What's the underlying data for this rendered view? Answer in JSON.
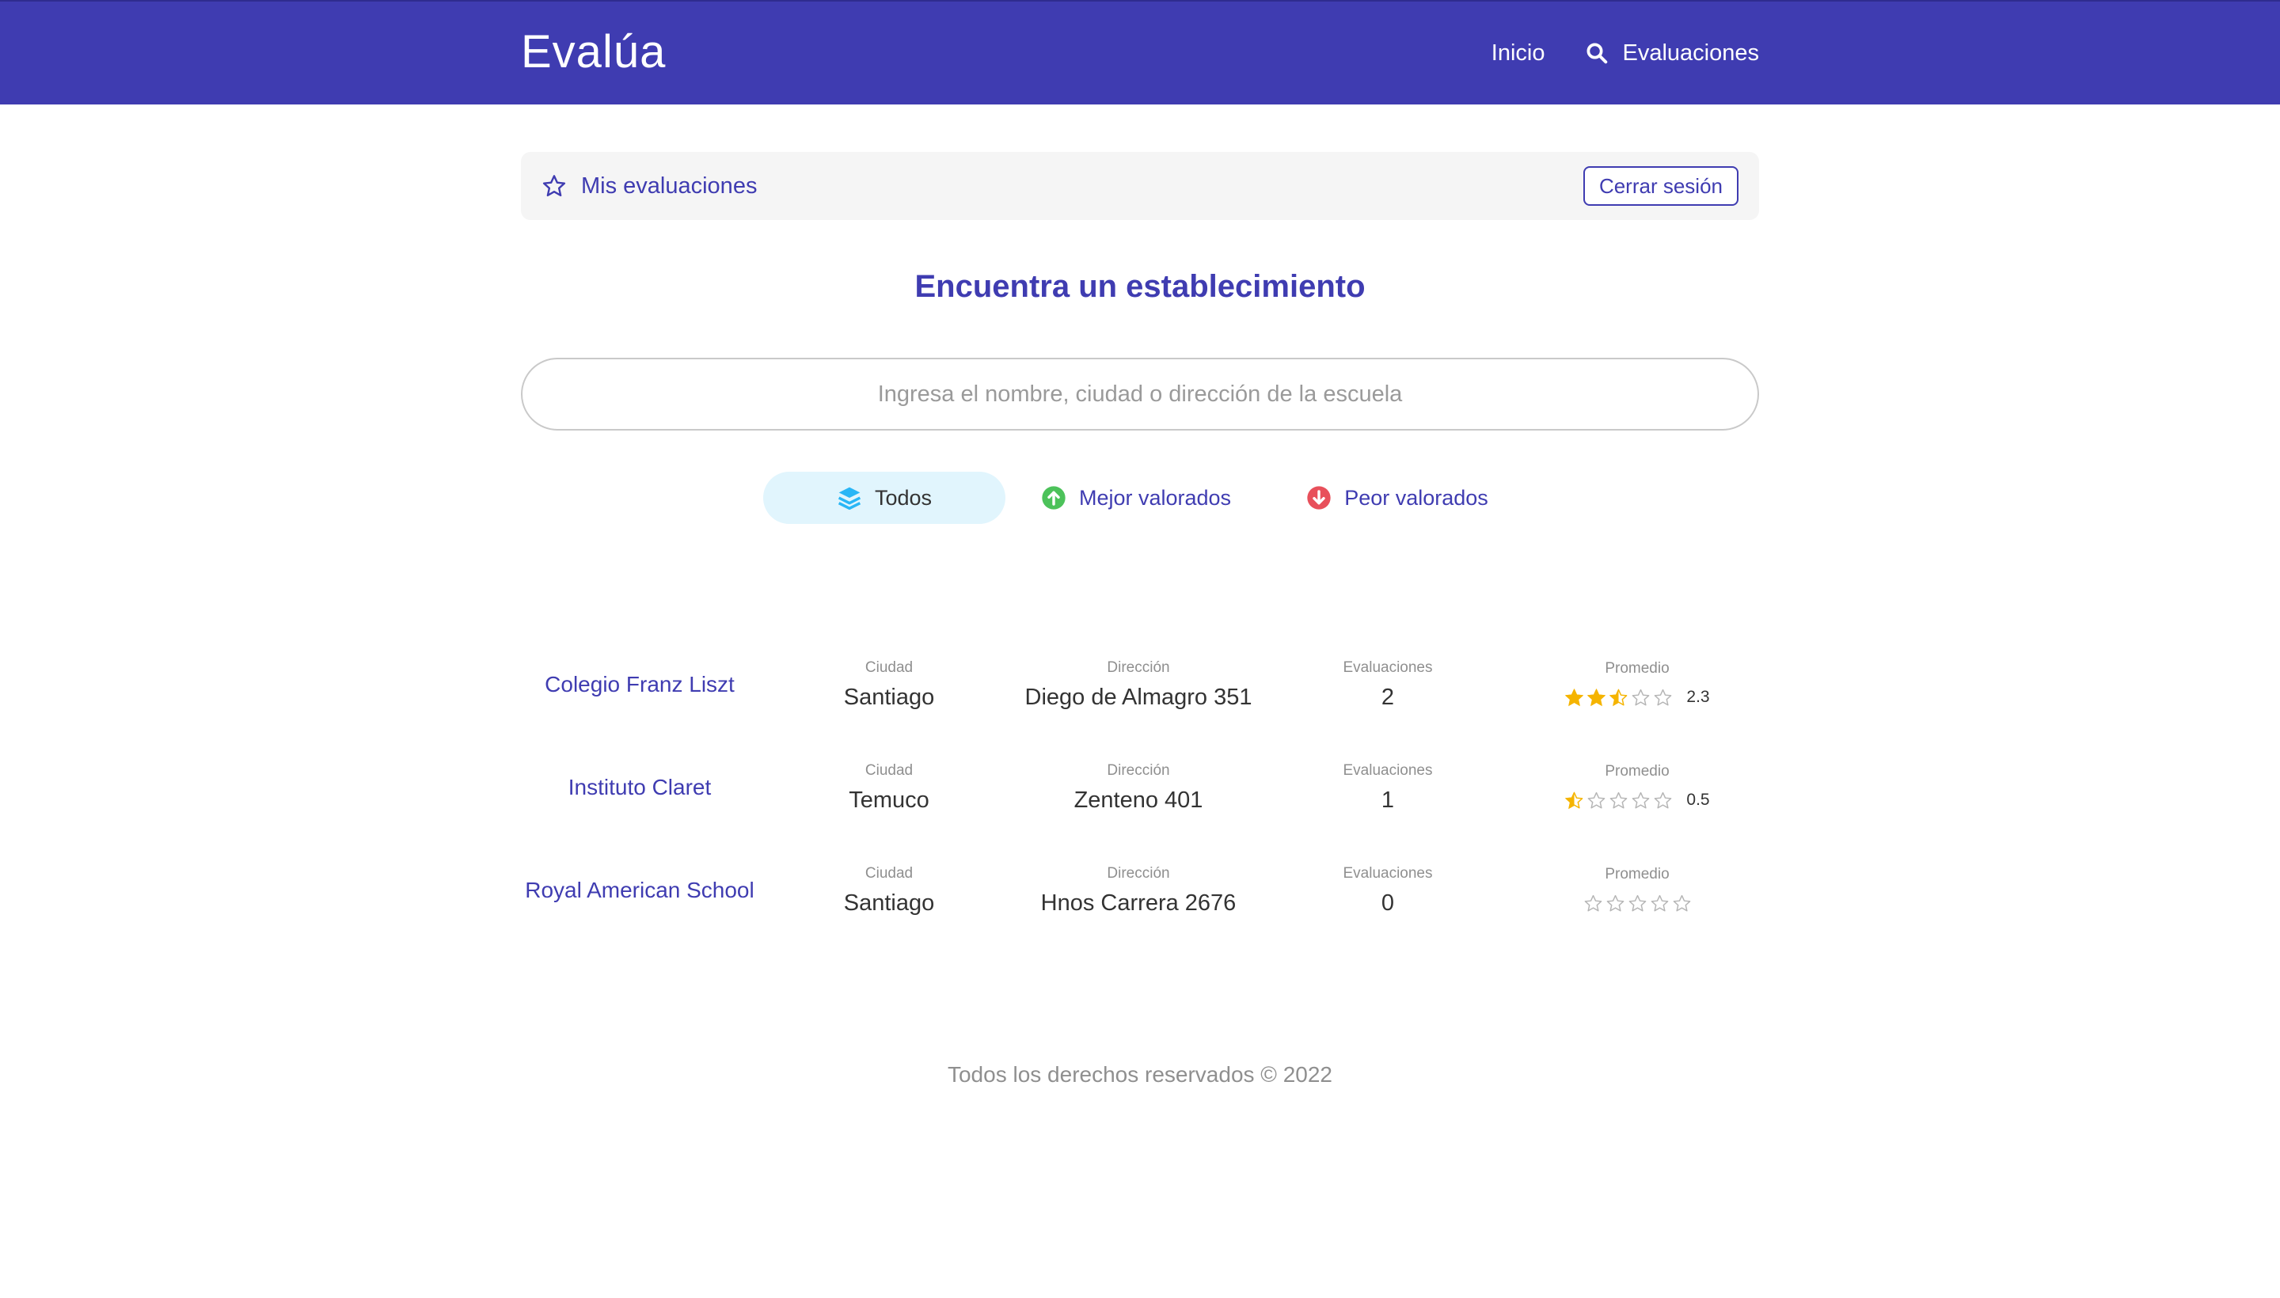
{
  "header": {
    "brand": "Evalúa",
    "nav": {
      "home": "Inicio",
      "evaluations": "Evaluaciones"
    },
    "color": "#3f3cb1"
  },
  "user_bar": {
    "my_evaluations": "Mis evaluaciones",
    "logout": "Cerrar sesión"
  },
  "main": {
    "heading": "Encuentra un establecimiento",
    "search_placeholder": "Ingresa el nombre, ciudad o dirección de la escuela",
    "filters": {
      "all": "Todos",
      "best": "Mejor valorados",
      "worst": "Peor valorados",
      "active": "all"
    }
  },
  "labels": {
    "city": "Ciudad",
    "address": "Dirección",
    "evaluations": "Evaluaciones",
    "average": "Promedio"
  },
  "schools": [
    {
      "name": "Colegio Franz Liszt",
      "city": "Santiago",
      "address": "Diego de Almagro 351",
      "evaluations": "2",
      "average": 2.3,
      "average_label": "2.3"
    },
    {
      "name": "Instituto Claret",
      "city": "Temuco",
      "address": "Zenteno 401",
      "evaluations": "1",
      "average": 0.5,
      "average_label": "0.5"
    },
    {
      "name": "Royal American School",
      "city": "Santiago",
      "address": "Hnos Carrera 2676",
      "evaluations": "0",
      "average": 0,
      "average_label": ""
    }
  ],
  "footer": {
    "text": "Todos los derechos reservados © 2022"
  },
  "colors": {
    "primary": "#3f3cb1",
    "star": "#f5b400",
    "best": "#4cc25a",
    "worst": "#e8505b",
    "all_icon": "#29b6f6"
  }
}
